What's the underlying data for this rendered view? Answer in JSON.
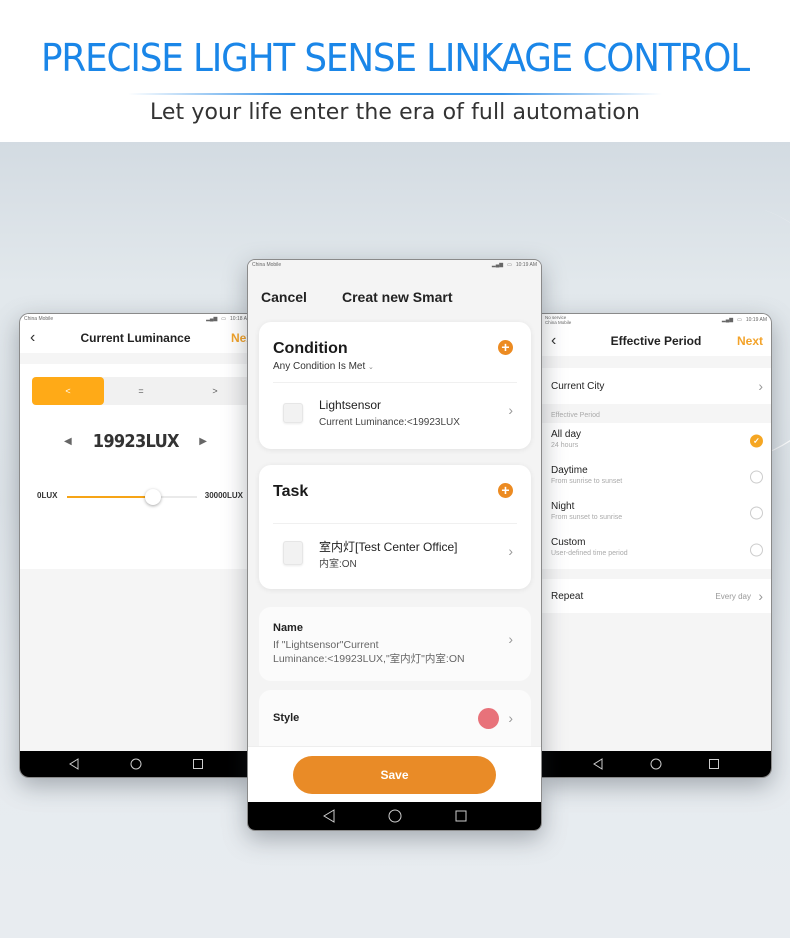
{
  "hero": {
    "title": "PRECISE LIGHT SENSE LINKAGE CONTROL",
    "subtitle": "Let your life enter the era of full automation"
  },
  "colors": {
    "hero_blue": "#1a86e8",
    "accent_orange": "#e98b27",
    "segment_orange": "#ffaa17",
    "style_dot": "#e8727a"
  },
  "left_phone": {
    "status": {
      "carrier": "China Mobile",
      "time": "10:18 A"
    },
    "header": {
      "title": "Current Luminance",
      "next": "Next"
    },
    "segments": [
      {
        "label": "<",
        "active": true
      },
      {
        "label": "=",
        "active": false
      },
      {
        "label": ">",
        "active": false
      }
    ],
    "value_label": "19923LUX",
    "slider": {
      "min_label": "0LUX",
      "max_label": "30000LUX",
      "min": 0,
      "max": 30000,
      "value": 19923
    }
  },
  "center_phone": {
    "status": {
      "carrier": "China Mobile",
      "time": "10:19 AM"
    },
    "header": {
      "cancel": "Cancel",
      "title": "Creat new Smart"
    },
    "condition": {
      "title": "Condition",
      "mode": "Any Condition Is Met",
      "item": {
        "name": "Lightsensor",
        "detail": "Current Luminance:<19923LUX"
      }
    },
    "task": {
      "title": "Task",
      "item": {
        "name": "室内灯[Test Center Office]",
        "detail": "内室:ON"
      }
    },
    "name_row": {
      "label": "Name",
      "value_line1": "If \"Lightsensor\"Current",
      "value_line2": "Luminance:<19923LUX,\"室内灯\"内室:ON"
    },
    "style_row": {
      "label": "Style"
    },
    "save_label": "Save"
  },
  "right_phone": {
    "status": {
      "carrier_line1": "No service",
      "carrier_line2": "China Mobile",
      "time": "10:19 AM"
    },
    "header": {
      "title": "Effective Period",
      "next": "Next"
    },
    "current_city_label": "Current City",
    "section_label": "Effective Period",
    "options": [
      {
        "title": "All day",
        "subtitle": "24 hours",
        "selected": true
      },
      {
        "title": "Daytime",
        "subtitle": "From sunrise to sunset",
        "selected": false
      },
      {
        "title": "Night",
        "subtitle": "From sunset to sunrise",
        "selected": false
      },
      {
        "title": "Custom",
        "subtitle": "User-defined time period",
        "selected": false
      }
    ],
    "repeat": {
      "label": "Repeat",
      "value": "Every day"
    }
  }
}
